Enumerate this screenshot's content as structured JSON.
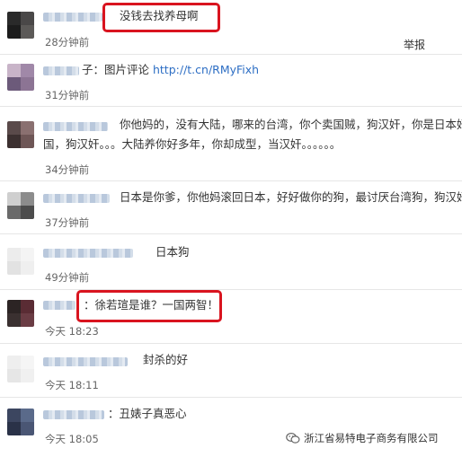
{
  "comments": [
    {
      "text": "没钱去找养母啊",
      "time": "28分钟前"
    },
    {
      "prefix": "子：图片评论 ",
      "link": "http://t.cn/RMyFixh",
      "time": "31分钟前"
    },
    {
      "line1": "你他妈的，没有大陆，哪来的台湾，你个卖国贼，狗汉奸，你是日本奸出",
      "line2": "国，狗汉奸。。。大陆养你好多年，你却成型，当汉奸。。。。。。",
      "time": "34分钟前"
    },
    {
      "text": "日本是你爹，你他妈滚回日本，好好做你的狗，最讨厌台湾狗，狗汉奸",
      "time": "37分钟前"
    },
    {
      "text": "日本狗",
      "time": "49分钟前"
    },
    {
      "text": "：徐若瑄是谁？一国两智！",
      "time": "今天 18:23"
    },
    {
      "text": "封杀的好",
      "time": "今天 18:11"
    },
    {
      "text": "：丑婊子真恶心",
      "time": "今天 18:05"
    }
  ],
  "report_label": "举报",
  "watermark": "浙江省易特电子商务有限公司",
  "colors": {
    "highlight": "#d9141f",
    "link": "#2d6ec4"
  }
}
